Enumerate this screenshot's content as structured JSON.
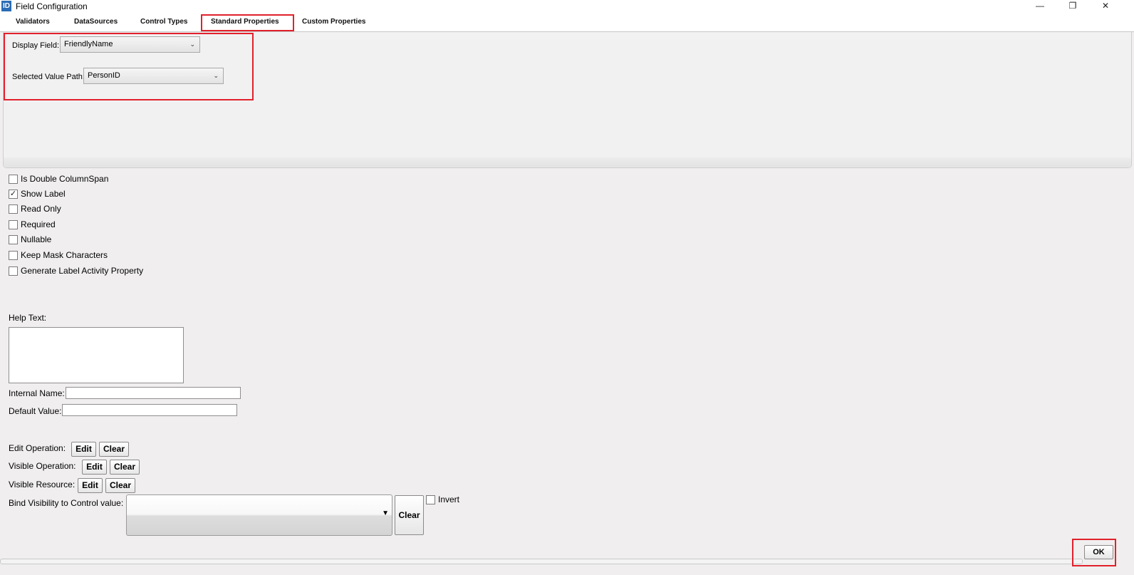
{
  "window": {
    "icon_text": "ID",
    "title": "Field Configuration",
    "minimize_glyph": "—",
    "maximize_glyph": "❐",
    "close_glyph": "✕"
  },
  "tabs": [
    {
      "label": "Validators"
    },
    {
      "label": "DataSources"
    },
    {
      "label": "Control Types"
    },
    {
      "label": "Standard Properties",
      "selected": true
    },
    {
      "label": "Custom Properties"
    }
  ],
  "standard_properties": {
    "display_field_label": "Display Field:",
    "display_field_value": "FriendlyName",
    "selected_value_path_label": "Selected Value Path:",
    "selected_value_path_value": "PersonID"
  },
  "checkboxes": [
    {
      "label": "Is Double ColumnSpan",
      "checked": false
    },
    {
      "label": "Show Label",
      "checked": true
    },
    {
      "label": "Read Only",
      "checked": false
    },
    {
      "label": "Required",
      "checked": false
    },
    {
      "label": "Nullable",
      "checked": false
    },
    {
      "label": "Keep Mask Characters",
      "checked": false
    },
    {
      "label": "Generate Label Activity Property",
      "checked": false
    }
  ],
  "fields": {
    "help_text_label": "Help Text:",
    "help_text_value": "",
    "internal_name_label": "Internal Name:",
    "internal_name_value": "",
    "default_value_label": "Default Value:",
    "default_value_value": ""
  },
  "operations": {
    "edit_operation_label": "Edit Operation:",
    "visible_operation_label": "Visible Operation:",
    "visible_resource_label": "Visible Resource:",
    "edit_button": "Edit",
    "clear_button": "Clear",
    "bind_visibility_label": "Bind Visibility to Control value:",
    "bind_visibility_value": "",
    "bind_clear_button": "Clear",
    "invert_label": "Invert",
    "invert_checked": false
  },
  "ok_button": "OK",
  "colors": {
    "highlight": "#e1212b",
    "app_icon": "#2b6cb5",
    "background": "#f0eeef"
  }
}
